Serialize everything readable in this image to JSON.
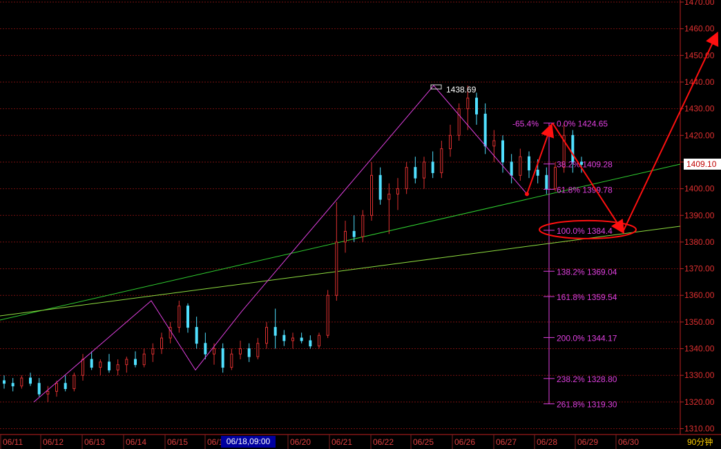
{
  "chart_data": {
    "type": "candlestick",
    "title": "",
    "timeframe_label": "90分钟",
    "cursor_label": "06/18,09:00",
    "current_price_label": "1409.10",
    "peak_label": "1438.69",
    "yaxis": {
      "min": 1305,
      "max": 1470,
      "ticks": [
        "1470.00",
        "1460.00",
        "1450.00",
        "1440.00",
        "1430.00",
        "1420.00",
        "1410.00",
        "1400.00",
        "1390.00",
        "1380.00",
        "1370.00",
        "1360.00",
        "1350.00",
        "1340.00",
        "1330.00",
        "1320.00",
        "1310.00"
      ]
    },
    "xaxis": {
      "ticks": [
        "06/11",
        "06/12",
        "06/13",
        "06/14",
        "06/15",
        "06/16",
        "06/20",
        "06/21",
        "06/22",
        "06/25",
        "06/26",
        "06/27",
        "06/28",
        "06/29",
        "06/30"
      ]
    },
    "grid": true,
    "candles": [
      {
        "o": 1328,
        "h": 1330,
        "l": 1325,
        "c": 1327
      },
      {
        "o": 1327,
        "h": 1329,
        "l": 1324,
        "c": 1326
      },
      {
        "o": 1326,
        "h": 1330,
        "l": 1325,
        "c": 1329
      },
      {
        "o": 1329,
        "h": 1331,
        "l": 1326,
        "c": 1327
      },
      {
        "o": 1327,
        "h": 1329,
        "l": 1322,
        "c": 1323
      },
      {
        "o": 1323,
        "h": 1326,
        "l": 1320,
        "c": 1324
      },
      {
        "o": 1324,
        "h": 1328,
        "l": 1322,
        "c": 1327
      },
      {
        "o": 1327,
        "h": 1330,
        "l": 1324,
        "c": 1325
      },
      {
        "o": 1325,
        "h": 1331,
        "l": 1324,
        "c": 1330
      },
      {
        "o": 1330,
        "h": 1338,
        "l": 1328,
        "c": 1336
      },
      {
        "o": 1336,
        "h": 1339,
        "l": 1332,
        "c": 1333
      },
      {
        "o": 1333,
        "h": 1336,
        "l": 1330,
        "c": 1335
      },
      {
        "o": 1335,
        "h": 1338,
        "l": 1331,
        "c": 1332
      },
      {
        "o": 1332,
        "h": 1336,
        "l": 1330,
        "c": 1334
      },
      {
        "o": 1334,
        "h": 1337,
        "l": 1331,
        "c": 1336
      },
      {
        "o": 1336,
        "h": 1339,
        "l": 1333,
        "c": 1334
      },
      {
        "o": 1334,
        "h": 1340,
        "l": 1333,
        "c": 1338
      },
      {
        "o": 1338,
        "h": 1342,
        "l": 1335,
        "c": 1340
      },
      {
        "o": 1340,
        "h": 1346,
        "l": 1338,
        "c": 1344
      },
      {
        "o": 1344,
        "h": 1350,
        "l": 1342,
        "c": 1348
      },
      {
        "o": 1348,
        "h": 1358,
        "l": 1346,
        "c": 1356
      },
      {
        "o": 1356,
        "h": 1357,
        "l": 1346,
        "c": 1348
      },
      {
        "o": 1348,
        "h": 1352,
        "l": 1340,
        "c": 1342
      },
      {
        "o": 1342,
        "h": 1346,
        "l": 1336,
        "c": 1338
      },
      {
        "o": 1338,
        "h": 1342,
        "l": 1334,
        "c": 1340
      },
      {
        "o": 1340,
        "h": 1342,
        "l": 1331,
        "c": 1333
      },
      {
        "o": 1333,
        "h": 1340,
        "l": 1332,
        "c": 1338
      },
      {
        "o": 1338,
        "h": 1343,
        "l": 1336,
        "c": 1340
      },
      {
        "o": 1340,
        "h": 1342,
        "l": 1335,
        "c": 1337
      },
      {
        "o": 1337,
        "h": 1344,
        "l": 1336,
        "c": 1342
      },
      {
        "o": 1342,
        "h": 1350,
        "l": 1340,
        "c": 1348
      },
      {
        "o": 1348,
        "h": 1355,
        "l": 1340,
        "c": 1345
      },
      {
        "o": 1345,
        "h": 1347,
        "l": 1341,
        "c": 1343
      },
      {
        "o": 1343,
        "h": 1346,
        "l": 1340,
        "c": 1344
      },
      {
        "o": 1344,
        "h": 1346,
        "l": 1342,
        "c": 1343
      },
      {
        "o": 1343,
        "h": 1345,
        "l": 1340,
        "c": 1341
      },
      {
        "o": 1341,
        "h": 1346,
        "l": 1340,
        "c": 1345
      },
      {
        "o": 1345,
        "h": 1362,
        "l": 1344,
        "c": 1360
      },
      {
        "o": 1360,
        "h": 1395,
        "l": 1358,
        "c": 1380
      },
      {
        "o": 1380,
        "h": 1388,
        "l": 1376,
        "c": 1384
      },
      {
        "o": 1384,
        "h": 1390,
        "l": 1380,
        "c": 1382
      },
      {
        "o": 1382,
        "h": 1392,
        "l": 1380,
        "c": 1390
      },
      {
        "o": 1390,
        "h": 1410,
        "l": 1388,
        "c": 1405
      },
      {
        "o": 1405,
        "h": 1408,
        "l": 1394,
        "c": 1396
      },
      {
        "o": 1396,
        "h": 1402,
        "l": 1383,
        "c": 1398
      },
      {
        "o": 1398,
        "h": 1404,
        "l": 1392,
        "c": 1400
      },
      {
        "o": 1400,
        "h": 1410,
        "l": 1398,
        "c": 1408
      },
      {
        "o": 1408,
        "h": 1412,
        "l": 1402,
        "c": 1404
      },
      {
        "o": 1404,
        "h": 1412,
        "l": 1400,
        "c": 1410
      },
      {
        "o": 1410,
        "h": 1414,
        "l": 1404,
        "c": 1406
      },
      {
        "o": 1406,
        "h": 1418,
        "l": 1404,
        "c": 1415
      },
      {
        "o": 1415,
        "h": 1424,
        "l": 1412,
        "c": 1420
      },
      {
        "o": 1420,
        "h": 1432,
        "l": 1418,
        "c": 1430
      },
      {
        "o": 1430,
        "h": 1438.69,
        "l": 1422,
        "c": 1434
      },
      {
        "o": 1434,
        "h": 1436,
        "l": 1424,
        "c": 1428
      },
      {
        "o": 1428,
        "h": 1432,
        "l": 1413,
        "c": 1416
      },
      {
        "o": 1416,
        "h": 1422,
        "l": 1410,
        "c": 1418
      },
      {
        "o": 1418,
        "h": 1420,
        "l": 1406,
        "c": 1410
      },
      {
        "o": 1410,
        "h": 1413,
        "l": 1402,
        "c": 1405
      },
      {
        "o": 1405,
        "h": 1415,
        "l": 1403,
        "c": 1412
      },
      {
        "o": 1412,
        "h": 1414,
        "l": 1404,
        "c": 1407
      },
      {
        "o": 1407,
        "h": 1411,
        "l": 1402,
        "c": 1405
      },
      {
        "o": 1405,
        "h": 1408,
        "l": 1398,
        "c": 1400
      },
      {
        "o": 1400,
        "h": 1410,
        "l": 1399,
        "c": 1408
      },
      {
        "o": 1408,
        "h": 1424.65,
        "l": 1406,
        "c": 1420
      },
      {
        "o": 1420,
        "h": 1422,
        "l": 1406,
        "c": 1410
      },
      {
        "o": 1410,
        "h": 1412,
        "l": 1406,
        "c": 1409.1
      }
    ],
    "zigzag": [
      [
        1320,
        1320
      ],
      [
        1358,
        1358
      ],
      [
        1332,
        1332
      ],
      [
        1354,
        1354
      ],
      [
        1438.69,
        1438.69
      ]
    ],
    "fibonacci": [
      {
        "label": "0.0% 1424.65",
        "value": 1424.65
      },
      {
        "label": "38.2% 1409.28",
        "value": 1409.28
      },
      {
        "label": "61.8% 1399.78",
        "value": 1399.78
      },
      {
        "label": "100.0% 1384.4",
        "value": 1384.4
      },
      {
        "label": "138.2% 1369.04",
        "value": 1369.04
      },
      {
        "label": "161.8% 1359.54",
        "value": 1359.54
      },
      {
        "label": "200.0% 1344.17",
        "value": 1344.17
      },
      {
        "label": "238.2% 1328.80",
        "value": 1328.8
      },
      {
        "label": "261.8% 1319.30",
        "value": 1319.3
      }
    ],
    "fib_retrace_label": "-65.4%",
    "colors": {
      "up": "#e03030",
      "down": "#50e0ff",
      "grid": "#7a1010",
      "trend": "#40d040",
      "zigzag": "#e040e0",
      "annotation": "#ff1010"
    }
  }
}
